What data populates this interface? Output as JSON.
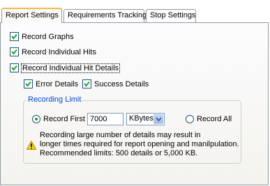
{
  "tabs": [
    {
      "label": "Report Settings",
      "active": true
    },
    {
      "label": "Requirements Tracking",
      "active": false
    },
    {
      "label": "Stop Settings",
      "active": false
    }
  ],
  "options": {
    "record_graphs": {
      "label": "Record Graphs",
      "checked": true
    },
    "record_individual_hits": {
      "label": "Record Individual Hits",
      "checked": true
    },
    "record_individual_hit_details": {
      "label": "Record Individual Hit Details",
      "checked": true
    },
    "error_details": {
      "label": "Error Details",
      "checked": true
    },
    "success_details": {
      "label": "Success Details",
      "checked": true
    }
  },
  "recording_limit": {
    "legend": "Recording Limit",
    "record_first_label": "Record First",
    "record_first_selected": true,
    "record_first_value": "7000",
    "unit_selected": "KBytes",
    "record_all_label": "Record All",
    "record_all_selected": false
  },
  "warning": {
    "icon": "warning-icon",
    "lines": [
      "Recording large number of details may result in",
      "longer times required for report opening and manilpulation.",
      "Recommended limits: 500 details or 5,000 KB."
    ]
  },
  "colors": {
    "check": "#21a121",
    "legend": "#0046d5",
    "active_tab_accent": "#f5b744"
  }
}
